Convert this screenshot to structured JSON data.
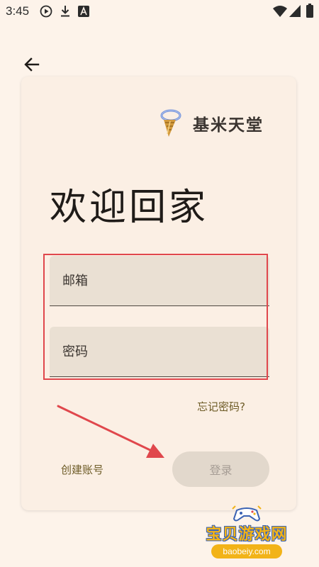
{
  "status_bar": {
    "time": "3:45",
    "icons": [
      "media-play-icon",
      "download-icon",
      "text-a-icon",
      "wifi-icon",
      "signal-icon",
      "battery-icon"
    ]
  },
  "nav": {
    "back_icon": "arrow-left-icon"
  },
  "brand": {
    "logo_icon": "ice-cream-logo-icon",
    "name": "基米天堂"
  },
  "login": {
    "heading": "欢迎回家",
    "email_placeholder": "邮箱",
    "password_placeholder": "密码",
    "forgot_password": "忘记密码?",
    "create_account": "创建账号",
    "login_button": "登录"
  },
  "annotations": {
    "highlight_color": "#e0474c",
    "arrow_color": "#e0474c"
  },
  "watermark": {
    "title": "宝贝游戏网",
    "url": "baobeiy.com"
  },
  "colors": {
    "background": "#fdf3ea",
    "card": "#fbefe4",
    "field": "#eae0d3",
    "link": "#6d5b26",
    "button_disabled": "#e2d8cc"
  }
}
